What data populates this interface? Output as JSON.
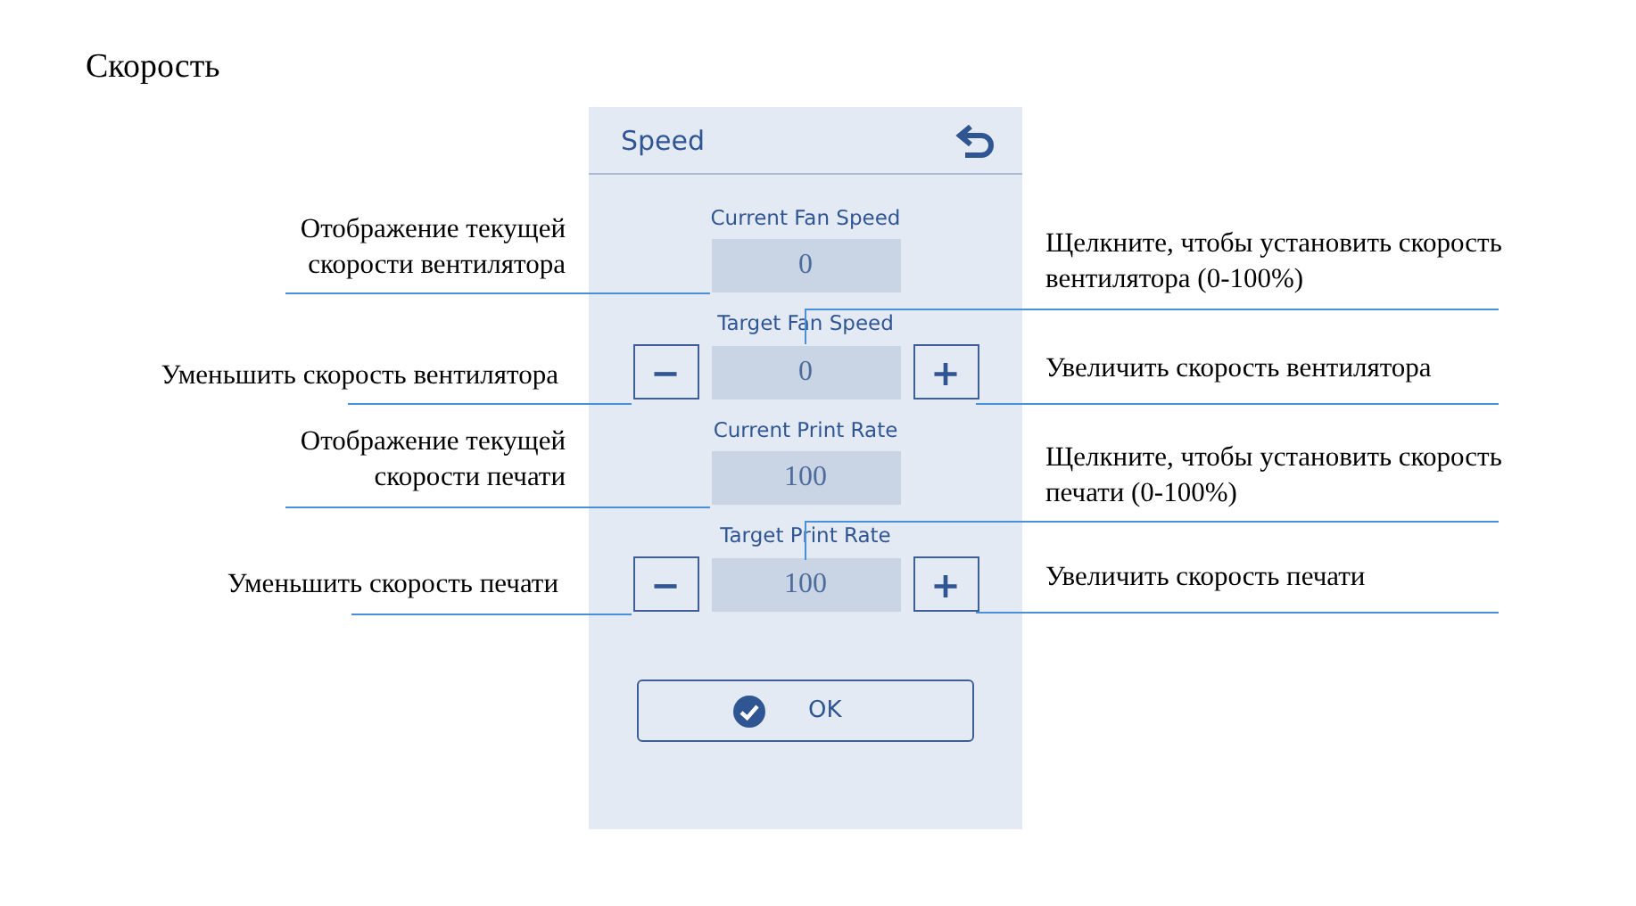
{
  "page_title": "Скорость",
  "screen": {
    "title": "Speed",
    "fields": [
      {
        "kind": "display",
        "label": "Current Fan Speed",
        "value": "0"
      },
      {
        "kind": "stepper",
        "label": "Target Fan Speed",
        "value": "0",
        "decrease": "−",
        "increase": "+"
      },
      {
        "kind": "display",
        "label": "Current Print Rate",
        "value": "100"
      },
      {
        "kind": "stepper",
        "label": "Target Print Rate",
        "value": "100",
        "decrease": "−",
        "increase": "+"
      }
    ],
    "ok_button": "OK"
  },
  "callouts": [
    {
      "text": "Отображение текущей\nскорости вентилятора"
    },
    {
      "text": "Щелкните, чтобы установить скорость\nвентилятора (0-100%)"
    },
    {
      "text": "Уменьшить скорость вентилятора"
    },
    {
      "text": "Увеличить скорость вентилятора"
    },
    {
      "text": "Отображение текущей\nскорости печати"
    },
    {
      "text": "Щелкните, чтобы установить скорость\nпечати (0-100%)"
    },
    {
      "text": "Уменьшить скорость печати"
    },
    {
      "text": "Увеличить скорость печати"
    }
  ]
}
